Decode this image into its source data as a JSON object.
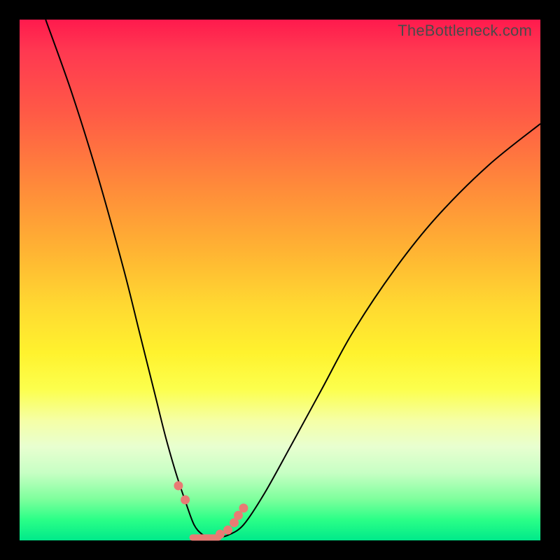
{
  "watermark": "TheBottleneck.com",
  "chart_data": {
    "type": "line",
    "title": "",
    "xlabel": "",
    "ylabel": "",
    "xlim": [
      0,
      100
    ],
    "ylim": [
      0,
      100
    ],
    "series": [
      {
        "name": "bottleneck-curve",
        "x": [
          5,
          10,
          15,
          20,
          23,
          26,
          28,
          30,
          32,
          33.5,
          35,
          36.5,
          38,
          40,
          43,
          47,
          52,
          58,
          64,
          72,
          80,
          90,
          100
        ],
        "y": [
          100,
          86,
          70,
          52,
          40,
          28,
          20,
          13,
          7,
          3,
          1.2,
          0.6,
          0.6,
          1.0,
          3,
          9,
          18,
          29,
          40,
          52,
          62,
          72,
          80
        ]
      }
    ],
    "markers": {
      "name": "highlight-dots",
      "x": [
        30.5,
        31.8,
        38.5,
        40.0,
        41.2,
        42.0,
        43.0
      ],
      "y": [
        10.5,
        7.8,
        1.2,
        2.0,
        3.4,
        4.8,
        6.2
      ]
    },
    "flat_segment": {
      "name": "valley-floor",
      "x": [
        33.2,
        38.2
      ],
      "y": [
        0.55,
        0.55
      ]
    },
    "gradient_note": "background encodes bottleneck severity: red high, green low"
  }
}
